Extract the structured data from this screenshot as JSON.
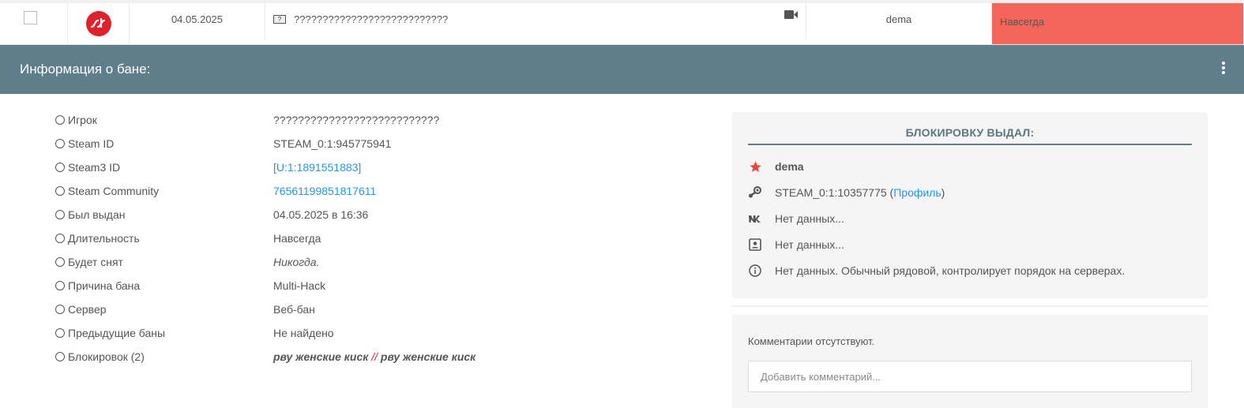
{
  "ban_row": {
    "date": "04.05.2025",
    "player_name": "???????????????????????????",
    "admin": "dema",
    "length": "Навсегда",
    "length_color": "#f4665a",
    "flag_icon": "unknown-flag-icon",
    "demo_icon": "video-camera-icon"
  },
  "header": {
    "title": "Информация о бане:",
    "color": "#607d8b"
  },
  "info": [
    {
      "label": "Игрок",
      "value": "???????????????????????????"
    },
    {
      "label": "Steam ID",
      "value": "STEAM_0:1:945775941"
    },
    {
      "label": "Steam3 ID",
      "value": "[U:1:1891551883]"
    },
    {
      "label": "Steam Community",
      "value": "76561199851817611"
    },
    {
      "label": "Был выдан",
      "value": "04.05.2025 в 16:36"
    },
    {
      "label": "Длительность",
      "value": "Навсегда"
    },
    {
      "label": "Будет снят",
      "value": "Никогда."
    },
    {
      "label": "Причина бана",
      "value": "Multi-Hack"
    },
    {
      "label": "Сервер",
      "value": "Веб-бан"
    },
    {
      "label": "Предыдущие баны",
      "value": "Не найдено"
    },
    {
      "label": "Блокировок (2)",
      "value_a": "рву женские киск",
      "separator": "//",
      "value_b": "рву женские киск"
    }
  ],
  "admin_panel": {
    "title": "БЛОКИРОВКУ ВЫДАЛ:",
    "name": "dema",
    "steam_id": "STEAM_0:1:10357775",
    "profile_open": " (",
    "profile_link": "Профиль",
    "profile_close": ")",
    "vk": "Нет данных...",
    "contact": "Нет данных...",
    "about": "Нет данных. Обычный рядовой, контролирует порядок на серверах."
  },
  "comments": {
    "empty_text": "Комментарии отсутствуют.",
    "placeholder": "Добавить комментарий..."
  }
}
